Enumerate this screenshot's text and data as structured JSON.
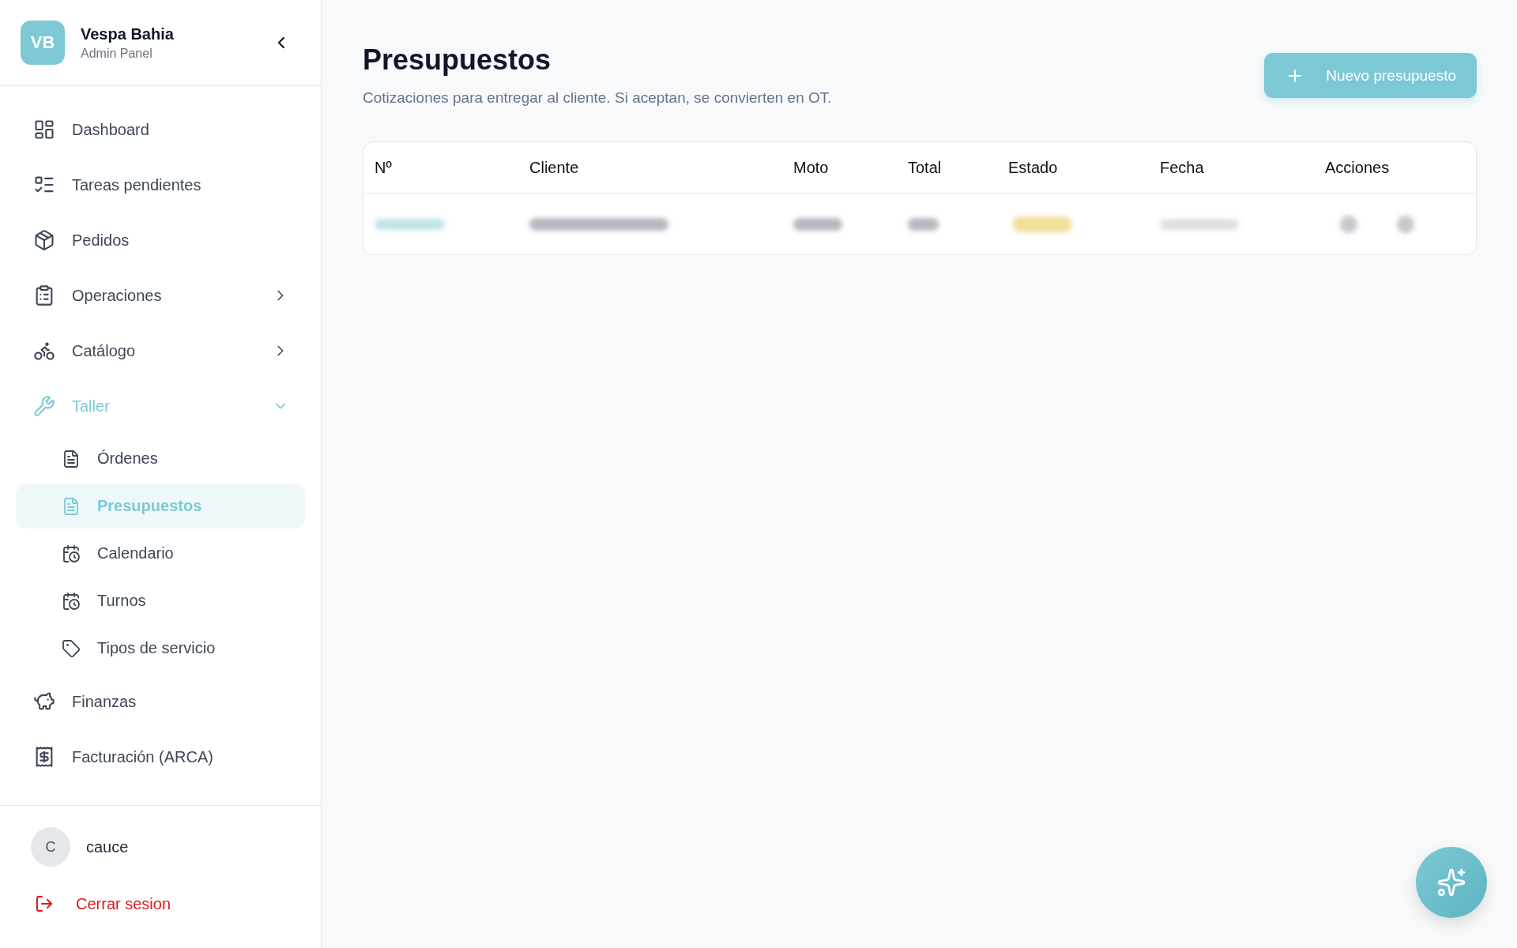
{
  "sidebar": {
    "brand": {
      "logo": "VB",
      "name": "Vespa Bahia",
      "subtitle": "Admin Panel"
    },
    "nav": [
      {
        "kind": "link",
        "label": "Dashboard",
        "selected": false
      },
      {
        "kind": "link",
        "label": "Tareas pendientes",
        "selected": false
      },
      {
        "kind": "link",
        "label": "Pedidos",
        "selected": false
      },
      {
        "kind": "group",
        "label": "Operaciones",
        "expanded": false,
        "selected": false
      },
      {
        "kind": "group",
        "label": "Catálogo",
        "expanded": false,
        "selected": false
      },
      {
        "kind": "group",
        "label": "Taller",
        "expanded": true,
        "selected": false,
        "children": [
          {
            "label": "Órdenes",
            "selected": false
          },
          {
            "label": "Presupuestos",
            "selected": true
          },
          {
            "label": "Calendario",
            "selected": false
          },
          {
            "label": "Turnos",
            "selected": false
          },
          {
            "label": "Tipos de servicio",
            "selected": false
          }
        ]
      },
      {
        "kind": "link",
        "label": "Finanzas",
        "selected": false
      },
      {
        "kind": "link",
        "label": "Facturación (ARCA)",
        "selected": false
      }
    ],
    "user": {
      "initial": "C",
      "name": "cauce"
    },
    "logout": "Cerrar sesion"
  },
  "page": {
    "title": "Presupuestos",
    "subtitle": "Cotizaciones para entregar al cliente. Si aceptan, se convierten en OT.",
    "new_button": "Nuevo presupuesto"
  },
  "table": {
    "columns": [
      "Nº",
      "Cliente",
      "Moto",
      "Total",
      "Estado",
      "Fecha",
      "Acciones"
    ],
    "rows": [
      {
        "cells": [
          {
            "kind": "link"
          },
          {
            "kind": "text"
          },
          {
            "kind": "text"
          },
          {
            "kind": "text"
          },
          {
            "kind": "badge"
          },
          {
            "kind": "date"
          },
          {
            "kind": "actions"
          }
        ]
      }
    ]
  }
}
